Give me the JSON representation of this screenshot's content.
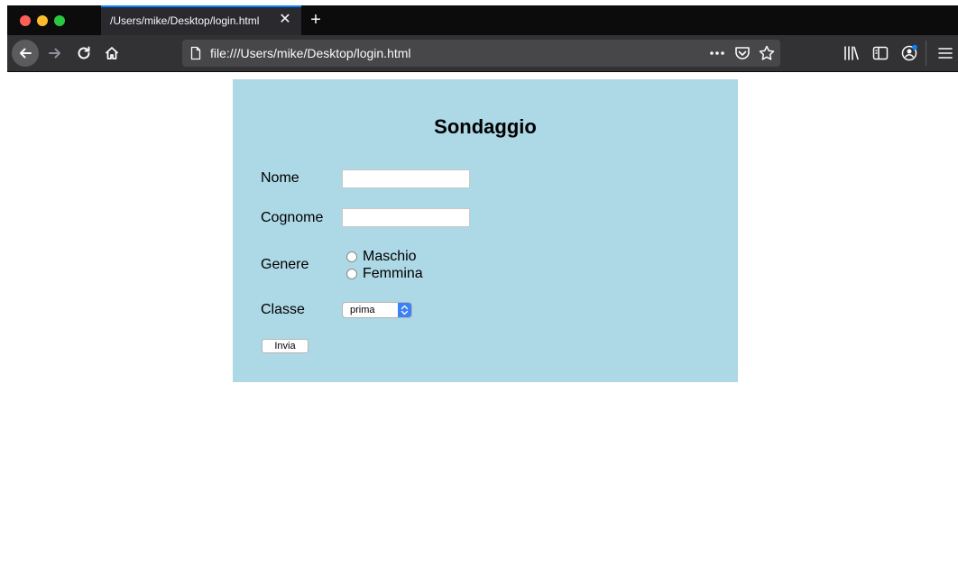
{
  "browser": {
    "tab_title": "/Users/mike/Desktop/login.html",
    "url": "file:///Users/mike/Desktop/login.html",
    "accent_color": "#0a84ff"
  },
  "icons": {
    "close": "close-icon",
    "new_tab": "plus-icon",
    "back": "arrow-left-icon",
    "forward": "arrow-right-icon",
    "reload": "reload-icon",
    "home": "home-icon",
    "page": "page-icon",
    "more": "more-icon",
    "pocket": "pocket-icon",
    "bookmark": "star-icon",
    "library": "library-icon",
    "sidebar": "sidebar-icon",
    "account": "account-icon",
    "menu": "hamburger-icon"
  },
  "form": {
    "title": "Sondaggio",
    "background": "#add8e6",
    "nome_label": "Nome",
    "nome_value": "",
    "cognome_label": "Cognome",
    "cognome_value": "",
    "genere_label": "Genere",
    "genere_options": [
      "Maschio",
      "Femmina"
    ],
    "classe_label": "Classe",
    "classe_value": "prima",
    "submit_label": "Invia"
  }
}
